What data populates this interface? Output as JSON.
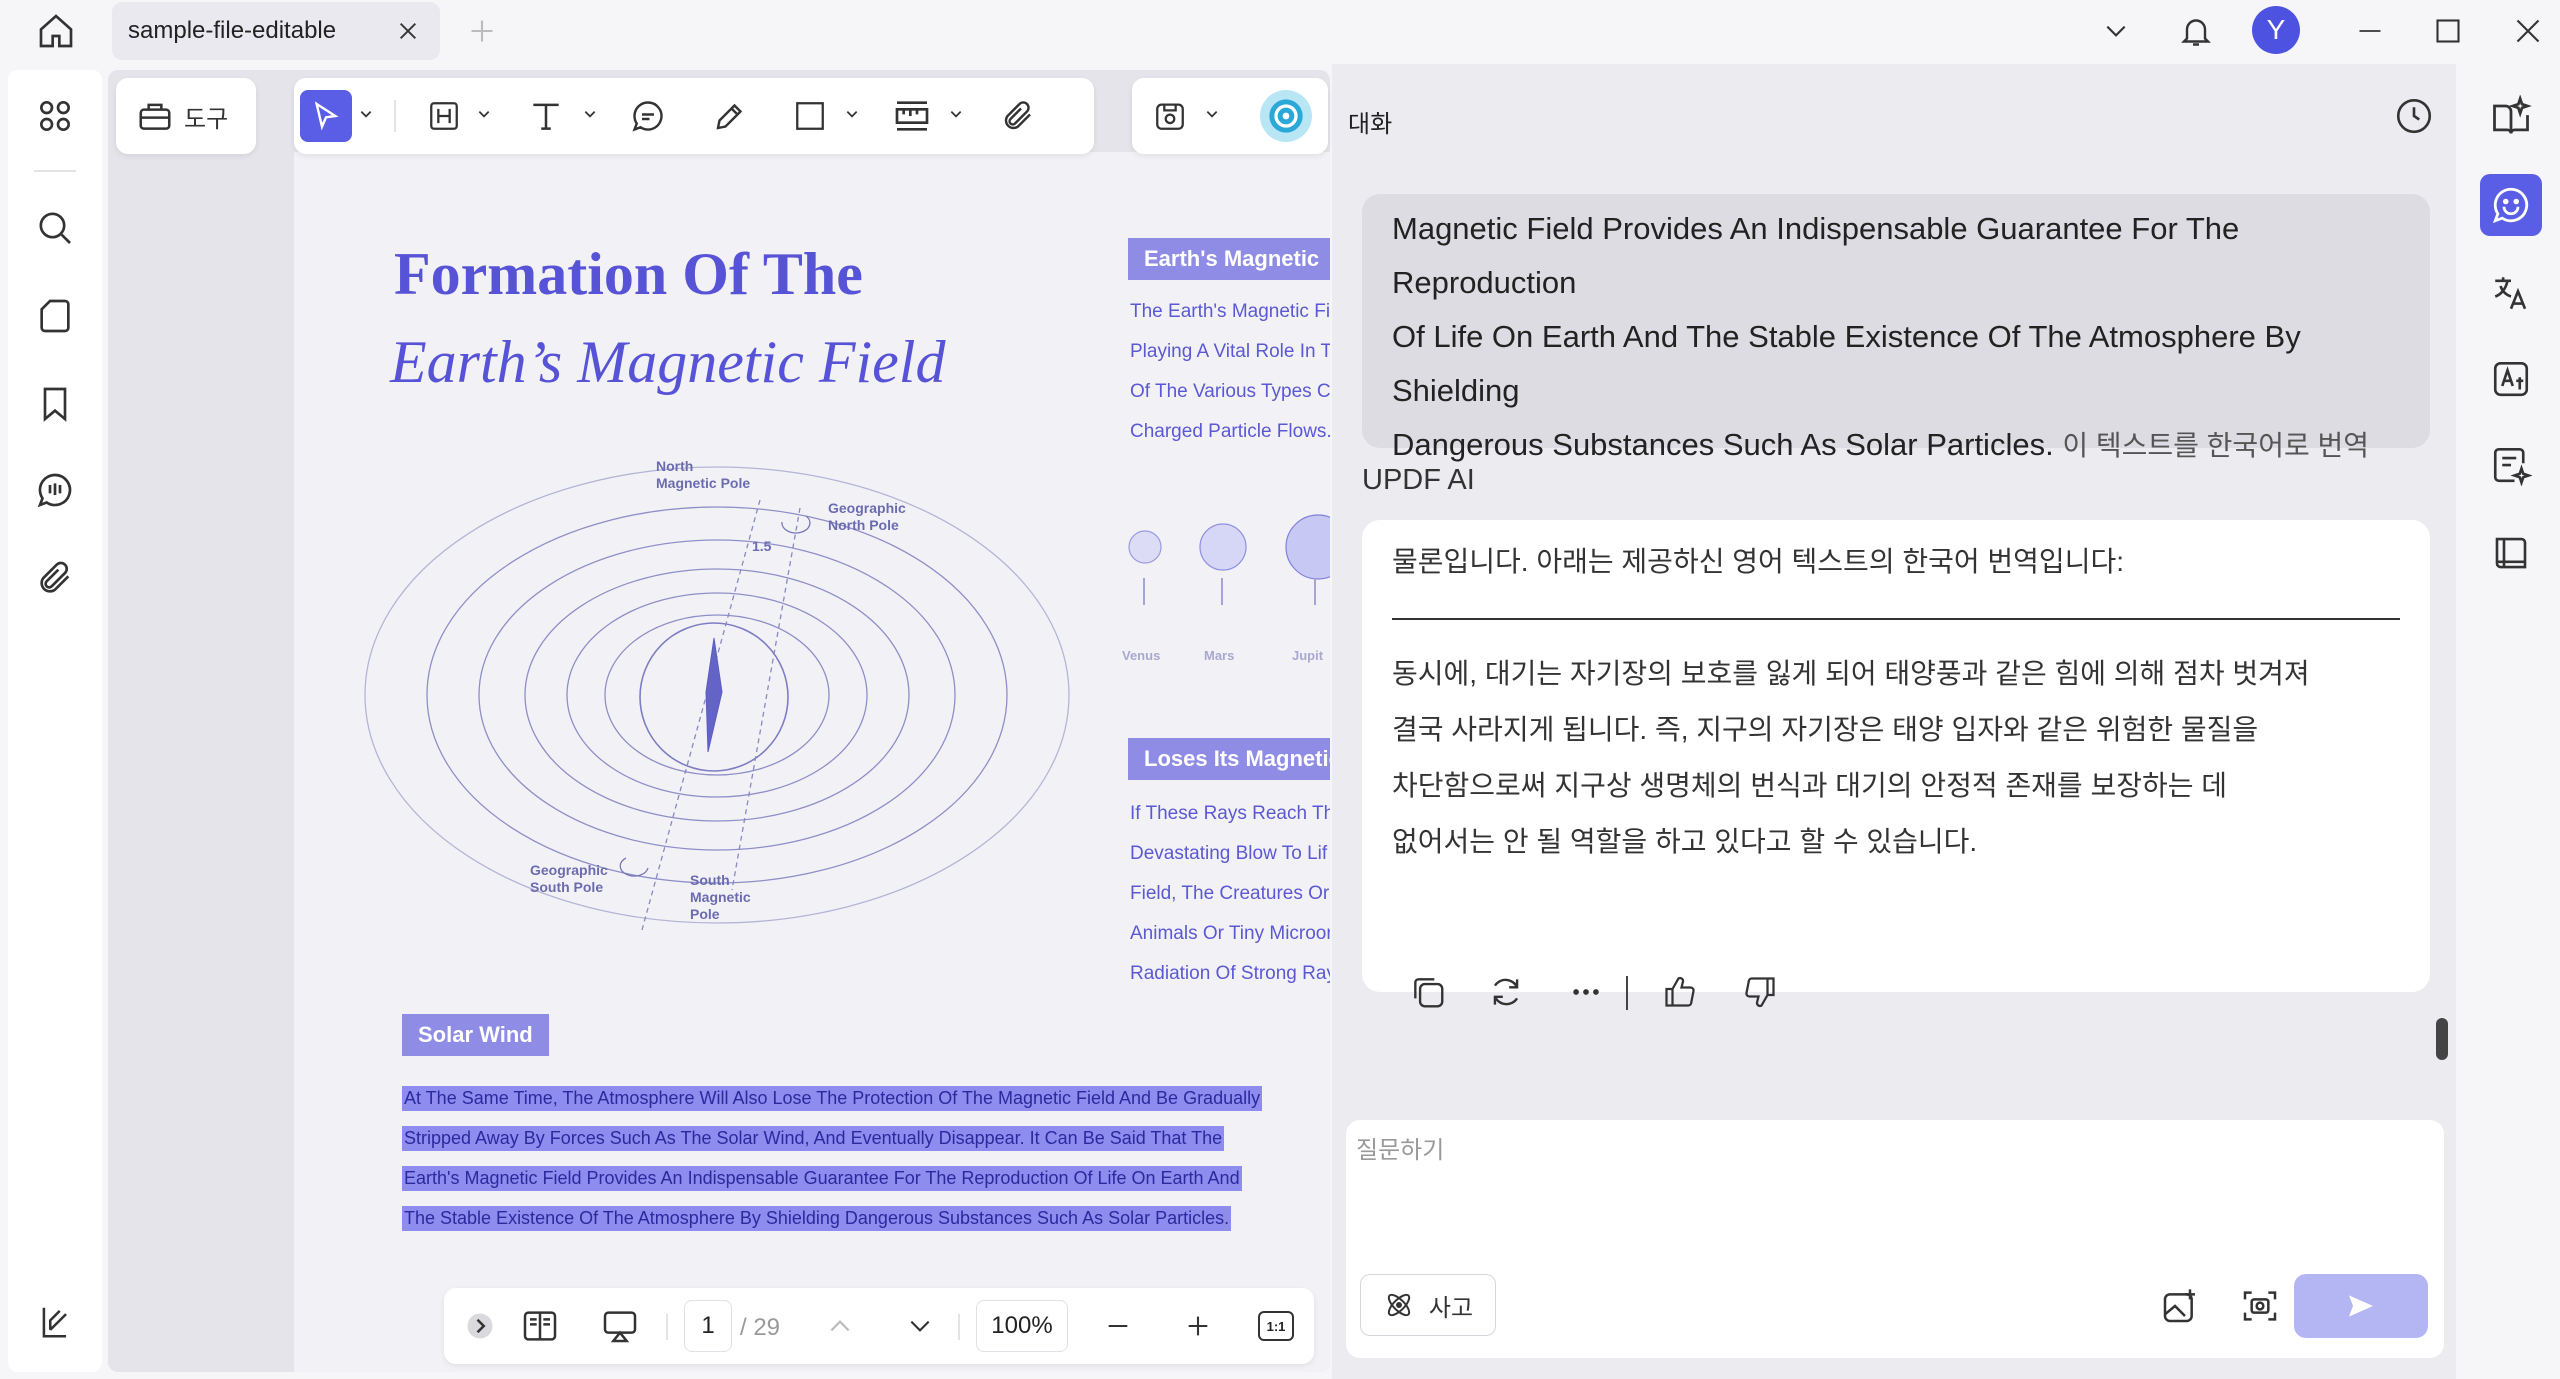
{
  "tab": {
    "title": "sample-file-editable"
  },
  "user": {
    "avatar_initial": "Y"
  },
  "toolbar": {
    "tools_label": "도구"
  },
  "pdf": {
    "title_line1": "Formation Of The",
    "title_line2": "Earth’s Magnetic Field",
    "badge_magnetic": "Earth's Magnetic",
    "side_text": [
      "The Earth's Magnetic Fi",
      "Playing A Vital Role In T",
      "Of The Various Types C",
      "Charged Particle Flows."
    ],
    "planets": [
      "Venus",
      "Mars",
      "Jupit"
    ],
    "badge_loses": "Loses Its Magnetic",
    "side_text2": [
      "If These Rays Reach Th",
      "Devastating Blow To Lif",
      "Field, The Creatures Or",
      "Animals Or Tiny Microor",
      "Radiation Of Strong Ray"
    ],
    "diagram_labels": {
      "north_magnetic": [
        "North",
        "Magnetic Pole"
      ],
      "geographic_north": [
        "Geographic",
        "North Pole"
      ],
      "angle": "1.5",
      "geographic_south": [
        "Geographic",
        "South Pole"
      ],
      "south_magnetic": [
        "South",
        "Magnetic",
        "Pole"
      ]
    },
    "badge_solar": "Solar Wind",
    "highlighted_paragraph": [
      "At The Same Time, The Atmosphere Will Also Lose The Protection Of The Magnetic Field And Be Gradually",
      "Stripped Away By Forces Such As The Solar Wind, And Eventually Disappear. It Can Be Said That The",
      "Earth's Magnetic Field Provides An Indispensable Guarantee For The Reproduction Of Life On Earth And",
      "The Stable Existence Of The Atmosphere By Shielding Dangerous Substances Such As Solar Particles."
    ]
  },
  "pager": {
    "current_page": "1",
    "total_pages": "/ 29",
    "zoom": "100%",
    "fit_label": "1:1"
  },
  "chat": {
    "header_title": "대화",
    "user_message_lines": [
      "Magnetic Field Provides An Indispensable Guarantee For The Reproduction",
      "Of Life On Earth And The Stable Existence Of The Atmosphere By Shielding",
      "Dangerous Substances Such As Solar Particles."
    ],
    "user_message_suffix": "이 텍스트를 한국어로 번역",
    "ai_label": "UPDF AI",
    "ai_intro": "물론입니다. 아래는 제공하신 영어 텍스트의 한국어 번역입니다:",
    "ai_translation_lines": [
      "동시에, 대기는 자기장의 보호를 잃게 되어 태양풍과 같은 힘에 의해 점차 벗겨져",
      "결국 사라지게 됩니다. 즉, 지구의 자기장은 태양 입자와 같은 위험한 물질을",
      "차단함으로써 지구상 생명체의 번식과 대기의 안정적 존재를 보장하는 데",
      "없어서는 안 될 역할을 하고 있다고 할 수 있습니다."
    ],
    "input_placeholder": "질문하기",
    "think_label": "사고"
  },
  "colors": {
    "accent": "#4d52e0",
    "pdf_title": "#5753d6",
    "highlight": "#8f8cf0",
    "send_disabled": "#b4b6f4"
  }
}
